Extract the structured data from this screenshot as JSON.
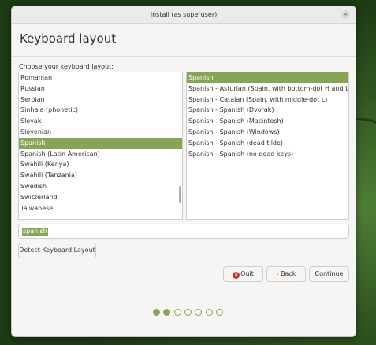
{
  "window": {
    "title": "Install (as superuser)",
    "close_glyph": "×"
  },
  "header": {
    "title": "Keyboard layout"
  },
  "prompt": "Choose your keyboard layout:",
  "layouts": [
    "Romanian",
    "Russian",
    "Serbian",
    "Sinhala (phonetic)",
    "Slovak",
    "Slovenian",
    "Spanish",
    "Spanish (Latin American)",
    "Swahili (Kenya)",
    "Swahili (Tanzania)",
    "Swedish",
    "Switzerland",
    "Taiwanese"
  ],
  "selected_layout": "Spanish",
  "variants": [
    "Spanish",
    "Spanish - Asturian (Spain, with bottom-dot H and L)",
    "Spanish - Catalan (Spain, with middle-dot L)",
    "Spanish - Spanish (Dvorak)",
    "Spanish - Spanish (Macintosh)",
    "Spanish - Spanish (Windows)",
    "Spanish - Spanish (dead tilde)",
    "Spanish - Spanish (no dead keys)"
  ],
  "selected_variant": "Spanish",
  "search": {
    "value": "spanish"
  },
  "buttons": {
    "detect": "Detect Keyboard Layout",
    "quit": "Quit",
    "back": "Back",
    "continue": "Continue"
  },
  "icons": {
    "quit": "quit-icon",
    "back": "back-arrow-icon",
    "close": "close-icon"
  },
  "progress": {
    "total_steps": 7,
    "current_step": 2
  },
  "colors": {
    "accent": "#87a556",
    "quit": "#c0392b",
    "back": "#e06c2c"
  }
}
